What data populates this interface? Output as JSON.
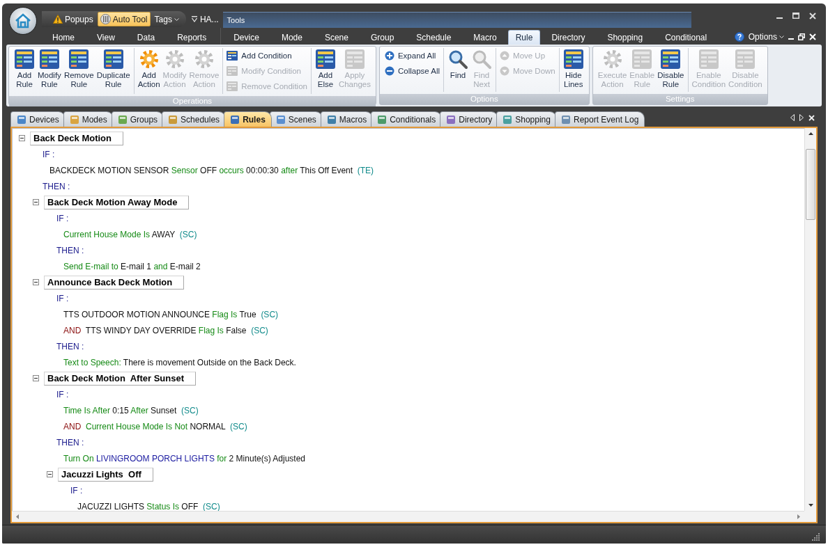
{
  "quick_access": {
    "items": [
      {
        "label": "Popups",
        "selected": false,
        "dropdown": false
      },
      {
        "label": "Auto Tool",
        "selected": true,
        "dropdown": false
      },
      {
        "label": "Tags",
        "selected": false,
        "dropdown": true
      }
    ],
    "document_title": "HA..."
  },
  "contextual_title": "Tools",
  "ribbon_tabs": [
    {
      "label": "Home",
      "selected": false
    },
    {
      "label": "View",
      "selected": false
    },
    {
      "label": "Data",
      "selected": false
    },
    {
      "label": "Reports",
      "selected": false
    },
    {
      "label": "Device",
      "selected": false
    },
    {
      "label": "Mode",
      "selected": false
    },
    {
      "label": "Scene",
      "selected": false
    },
    {
      "label": "Group",
      "selected": false
    },
    {
      "label": "Schedule",
      "selected": false
    },
    {
      "label": "Macro",
      "selected": false
    },
    {
      "label": "Rule",
      "selected": true
    },
    {
      "label": "Directory",
      "selected": false
    },
    {
      "label": "Shopping",
      "selected": false
    },
    {
      "label": "Conditional",
      "selected": false
    }
  ],
  "options_menu": {
    "label": "Options"
  },
  "ribbon_groups": [
    {
      "title": "Operations",
      "clusters": [
        [
          {
            "label": "Add Rule",
            "kind": "large",
            "disabled": false
          },
          {
            "label": "Modify Rule",
            "kind": "large",
            "disabled": false
          },
          {
            "label": "Remove Rule",
            "kind": "large",
            "disabled": false
          },
          {
            "label": "Duplicate Rule",
            "kind": "large",
            "disabled": false
          }
        ],
        [
          {
            "label": "Add Action",
            "kind": "large",
            "disabled": false
          },
          {
            "label": "Modify Action",
            "kind": "large",
            "disabled": true
          },
          {
            "label": "Remove Action",
            "kind": "large",
            "disabled": true
          }
        ],
        [
          {
            "label": "Add Condition",
            "kind": "small",
            "disabled": false
          },
          {
            "label": "Modify Condition",
            "kind": "small",
            "disabled": true
          },
          {
            "label": "Remove Condition",
            "kind": "small",
            "disabled": true
          }
        ],
        [
          {
            "label": "Add Else",
            "kind": "large",
            "disabled": false
          },
          {
            "label": "Apply Changes",
            "kind": "large",
            "disabled": true
          }
        ]
      ]
    },
    {
      "title": "Options",
      "clusters": [
        [
          {
            "label": "Expand All",
            "kind": "small",
            "disabled": false
          },
          {
            "label": "Collapse All",
            "kind": "small",
            "disabled": false
          }
        ],
        [
          {
            "label": "Find",
            "kind": "large",
            "disabled": false
          },
          {
            "label": "Find Next",
            "kind": "large",
            "disabled": true
          }
        ],
        [
          {
            "label": "Move Up",
            "kind": "small",
            "disabled": true
          },
          {
            "label": "Move Down",
            "kind": "small",
            "disabled": true
          }
        ],
        [
          {
            "label": "Hide Lines",
            "kind": "large",
            "disabled": false
          }
        ]
      ]
    },
    {
      "title": "Settings",
      "clusters": [
        [
          {
            "label": "Execute Action",
            "kind": "large",
            "disabled": true
          },
          {
            "label": "Enable Rule",
            "kind": "large",
            "disabled": true
          },
          {
            "label": "Disable Rule",
            "kind": "large",
            "disabled": false
          }
        ],
        [
          {
            "label": "Enable Condition",
            "kind": "large",
            "disabled": true
          },
          {
            "label": "Disable Condition",
            "kind": "large",
            "disabled": true
          }
        ]
      ]
    }
  ],
  "doc_tabs": [
    {
      "label": "Devices",
      "selected": false
    },
    {
      "label": "Modes",
      "selected": false
    },
    {
      "label": "Groups",
      "selected": false
    },
    {
      "label": "Schedules",
      "selected": false
    },
    {
      "label": "Rules",
      "selected": true
    },
    {
      "label": "Scenes",
      "selected": false
    },
    {
      "label": "Macros",
      "selected": false
    },
    {
      "label": "Conditionals",
      "selected": false
    },
    {
      "label": "Directory",
      "selected": false
    },
    {
      "label": "Shopping",
      "selected": false
    },
    {
      "label": "Report Event Log",
      "selected": false
    }
  ],
  "rules": [
    {
      "title": "Back Deck Motion",
      "expanded": true,
      "items": [
        {
          "kind": "if",
          "text": "IF :"
        },
        {
          "kind": "line",
          "segments": [
            {
              "kind": "name",
              "text": "BACKDECK MOTION SENSOR "
            },
            {
              "kind": "keyword",
              "text": "Sensor"
            },
            {
              "kind": "name",
              "text": " OFF "
            },
            {
              "kind": "keyword",
              "text": "occurs"
            },
            {
              "kind": "name",
              "text": " 00:00:30 "
            },
            {
              "kind": "keyword",
              "text": "after"
            },
            {
              "kind": "name",
              "text": " This Off Event  "
            },
            {
              "kind": "type",
              "text": "(TE)"
            }
          ]
        },
        {
          "kind": "then",
          "text": "THEN :"
        }
      ],
      "children": [
        {
          "title": "Back Deck Motion Away Mode",
          "expanded": true,
          "items": [
            {
              "kind": "if",
              "text": "IF :"
            },
            {
              "kind": "line",
              "segments": [
                {
                  "kind": "keyword",
                  "text": "Current House Mode Is"
                },
                {
                  "kind": "name",
                  "text": " AWAY  "
                },
                {
                  "kind": "type",
                  "text": "(SC)"
                }
              ]
            },
            {
              "kind": "then",
              "text": "THEN :"
            },
            {
              "kind": "line",
              "segments": [
                {
                  "kind": "keyword",
                  "text": "Send E-mail to"
                },
                {
                  "kind": "name",
                  "text": " E-mail 1 "
                },
                {
                  "kind": "keyword",
                  "text": "and"
                },
                {
                  "kind": "name",
                  "text": " E-mail 2"
                }
              ]
            }
          ]
        },
        {
          "title": "Announce Back Deck Motion",
          "expanded": true,
          "items": [
            {
              "kind": "if",
              "text": "IF :"
            },
            {
              "kind": "line",
              "segments": [
                {
                  "kind": "name",
                  "text": "TTS OUTDOOR MOTION ANNOUNCE "
                },
                {
                  "kind": "keyword",
                  "text": "Flag Is"
                },
                {
                  "kind": "name",
                  "text": " True  "
                },
                {
                  "kind": "type",
                  "text": "(SC)"
                }
              ]
            },
            {
              "kind": "line",
              "segments": [
                {
                  "kind": "and",
                  "text": "AND  "
                },
                {
                  "kind": "name",
                  "text": "TTS WINDY DAY OVERRIDE "
                },
                {
                  "kind": "keyword",
                  "text": "Flag Is"
                },
                {
                  "kind": "name",
                  "text": " False  "
                },
                {
                  "kind": "type",
                  "text": "(SC)"
                }
              ]
            },
            {
              "kind": "then",
              "text": "THEN :"
            },
            {
              "kind": "line",
              "segments": [
                {
                  "kind": "keyword",
                  "text": "Text to Speech:"
                },
                {
                  "kind": "name",
                  "text": " There is movement Outside on the Back Deck."
                }
              ]
            }
          ]
        },
        {
          "title": "Back Deck Motion  After Sunset",
          "expanded": true,
          "items": [
            {
              "kind": "if",
              "text": "IF :"
            },
            {
              "kind": "line",
              "segments": [
                {
                  "kind": "keyword",
                  "text": "Time Is After"
                },
                {
                  "kind": "name",
                  "text": " 0:15 "
                },
                {
                  "kind": "keyword",
                  "text": "After"
                },
                {
                  "kind": "name",
                  "text": " Sunset  "
                },
                {
                  "kind": "type",
                  "text": "(SC)"
                }
              ]
            },
            {
              "kind": "line",
              "segments": [
                {
                  "kind": "and",
                  "text": "AND  "
                },
                {
                  "kind": "keyword",
                  "text": "Current House Mode Is Not"
                },
                {
                  "kind": "name",
                  "text": " NORMAL  "
                },
                {
                  "kind": "type",
                  "text": "(SC)"
                }
              ]
            },
            {
              "kind": "then",
              "text": "THEN :"
            },
            {
              "kind": "line",
              "segments": [
                {
                  "kind": "keyword",
                  "text": "Turn On "
                },
                {
                  "kind": "device",
                  "text": "LIVINGROOM PORCH LIGHTS"
                },
                {
                  "kind": "keyword",
                  "text": " for"
                },
                {
                  "kind": "name",
                  "text": " 2 Minute(s) Adjusted"
                }
              ]
            }
          ],
          "children": [
            {
              "title": "Jacuzzi Lights  Off",
              "expanded": true,
              "items": [
                {
                  "kind": "if",
                  "text": "IF :"
                },
                {
                  "kind": "line",
                  "segments": [
                    {
                      "kind": "name",
                      "text": "JACUZZI LIGHTS "
                    },
                    {
                      "kind": "keyword",
                      "text": "Status Is"
                    },
                    {
                      "kind": "name",
                      "text": " OFF  "
                    },
                    {
                      "kind": "type",
                      "text": "(SC)"
                    }
                  ]
                }
              ]
            }
          ]
        }
      ]
    }
  ]
}
